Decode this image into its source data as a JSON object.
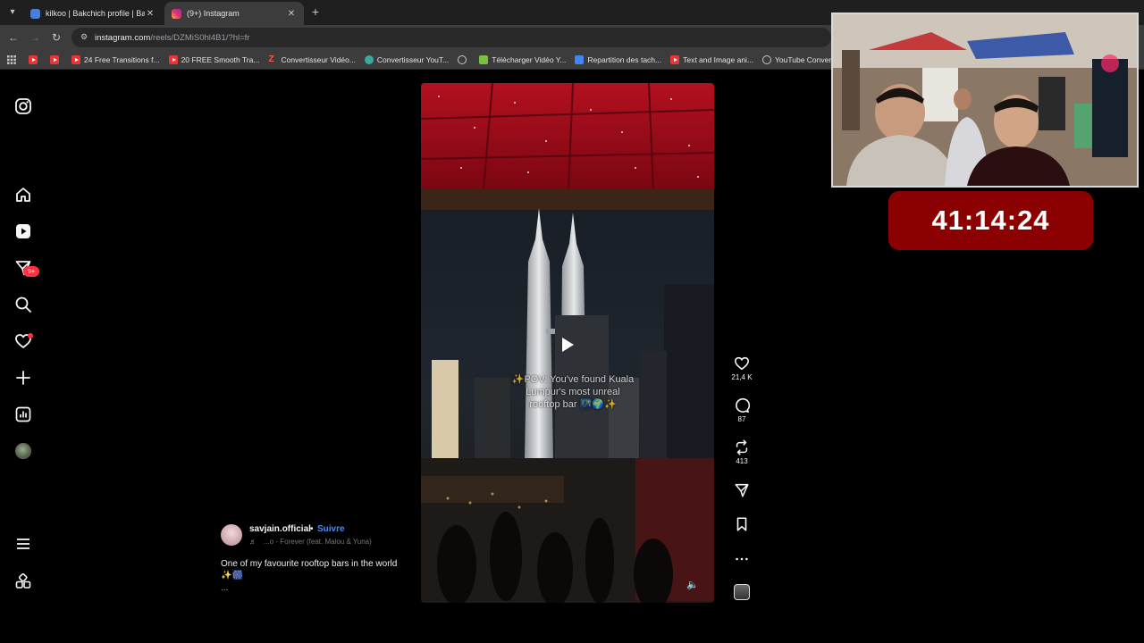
{
  "browser": {
    "tabs": [
      {
        "title": "kilkoo | Bakchich profile | Bakch",
        "favicon": "tab-favicon",
        "active": false
      },
      {
        "title": "(9+) Instagram",
        "favicon": "instagram-icon",
        "active": true
      }
    ],
    "url_host": "instagram.com",
    "url_path": "/reels/DZMiS0hl4B1/?hl=fr",
    "bookmarks": [
      {
        "label": "",
        "icon": "youtube-icon"
      },
      {
        "label": "",
        "icon": "youtube-icon"
      },
      {
        "label": "24 Free Transitions f...",
        "icon": "youtube-icon"
      },
      {
        "label": "20 FREE Smooth Tra...",
        "icon": "youtube-icon"
      },
      {
        "label": "Convertisseur Vidéo...",
        "icon": "z-icon"
      },
      {
        "label": "Convertisseur YouT...",
        "icon": "converter-icon"
      },
      {
        "label": "",
        "icon": "globe-icon"
      },
      {
        "label": "Télécharger Vidéo Y...",
        "icon": "download-icon"
      },
      {
        "label": "Repartition des tach...",
        "icon": "docs-icon"
      },
      {
        "label": "Text and Image ani...",
        "icon": "youtube-icon"
      },
      {
        "label": "YouTube Converter...",
        "icon": "globe-icon"
      }
    ]
  },
  "instagram": {
    "notification_badge": "9+",
    "reel": {
      "overlay_text": "✨POV: You've found Kuala Lumpur's most unreal rooftop bar 🌃🌍✨",
      "author": "savjain.official",
      "separator": "•",
      "follow_label": "Suivre",
      "music": "...o - Forever (feat. Malou & Yuna)",
      "caption": "One of my favourite rooftop bars in the world ✨🎆",
      "more": "..."
    },
    "actions": {
      "likes": "21,4 K",
      "comments": "87",
      "reposts": "413"
    }
  },
  "stream": {
    "timer": "41:14:24"
  },
  "colors": {
    "badge_red": "#ff3040",
    "follow_blue": "#4d8af0",
    "timer_bg": "#8b0000"
  }
}
